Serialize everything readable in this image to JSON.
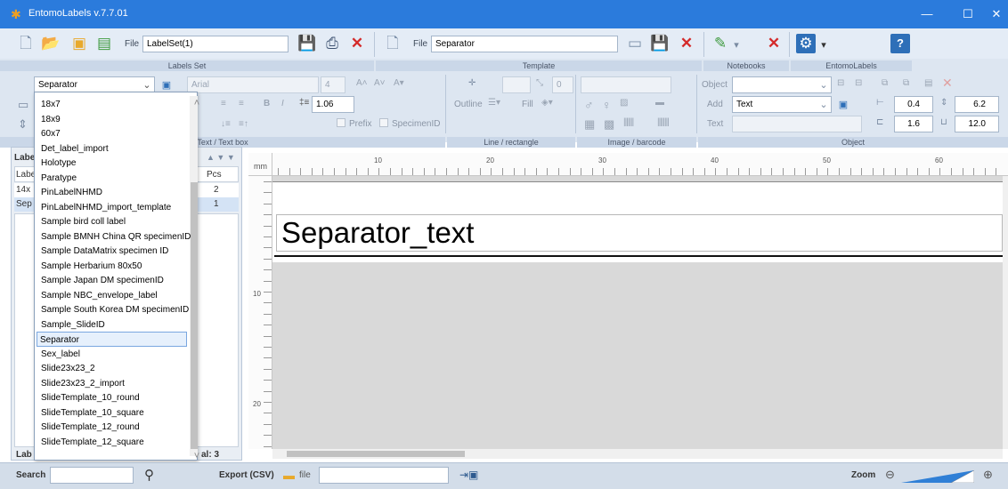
{
  "window": {
    "title": "EntomoLabels v.7.7.01",
    "controls": {
      "minimize": "—",
      "maximize": "☐",
      "close": "✕"
    }
  },
  "labels_set": {
    "file_label": "File",
    "file_value": "LabelSet(1)",
    "section": "Labels Set"
  },
  "template": {
    "file_label": "File",
    "file_value": "Separator",
    "section": "Template"
  },
  "notebooks": {
    "section": "Notebooks"
  },
  "entomolabels": {
    "section": "EntomoLabels"
  },
  "text_box": {
    "selected_template": "Separator",
    "font": "Arial",
    "size": "4",
    "line_spacing": "1.06",
    "prefix": "Prefix",
    "specimen_id": "SpecimenID",
    "section": "Text / Text box"
  },
  "line_rect": {
    "spin_value": "0",
    "outline_label": "Outline",
    "fill_label": "Fill",
    "section": "Line / rectangle"
  },
  "image_barcode": {
    "section": "Image / barcode"
  },
  "object": {
    "object_label": "Object",
    "add_label": "Add",
    "add_value": "Text",
    "text_label": "Text",
    "v1": "0.4",
    "v2": "6.2",
    "v3": "1.6",
    "v4": "12.0",
    "section": "Object"
  },
  "left_panel": {
    "header": "Labe",
    "col_label": "Labe",
    "col_pcs": "Pcs",
    "rows": [
      {
        "name": "14x",
        "pcs": "2"
      },
      {
        "name": "Sep",
        "pcs": "1"
      }
    ],
    "footer_left": "Lab",
    "footer_total": "al: 3"
  },
  "dropdown_items": [
    "18x7",
    "18x9",
    "60x7",
    "Det_label_import",
    "Holotype",
    "Paratype",
    "PinLabelNHMD",
    "PinLabelNHMD_import_template",
    "Sample bird coll label",
    "Sample BMNH China QR specimenID",
    "Sample DataMatrix specimen ID",
    "Sample Herbarium 80x50",
    "Sample Japan DM specimenID",
    "Sample NBC_envelope_label",
    "Sample South Korea DM specimenID",
    "Sample_SlideID",
    "Separator",
    "Sex_label",
    "Slide23x23_2",
    "Slide23x23_2_import",
    "SlideTemplate_10_round",
    "SlideTemplate_10_square",
    "SlideTemplate_12_round",
    "SlideTemplate_12_square"
  ],
  "dropdown_selected": "Separator",
  "ruler": {
    "unit": "mm",
    "h_marks": [
      "10",
      "20",
      "30",
      "40",
      "50",
      "60"
    ],
    "v_marks": [
      "10",
      "20"
    ]
  },
  "canvas": {
    "label_text": "Separator_text"
  },
  "status_bar": {
    "search_label": "Search",
    "search_value": "",
    "export_label": "Export (CSV)",
    "file_label": "file",
    "file_value": "",
    "zoom_label": "Zoom"
  }
}
